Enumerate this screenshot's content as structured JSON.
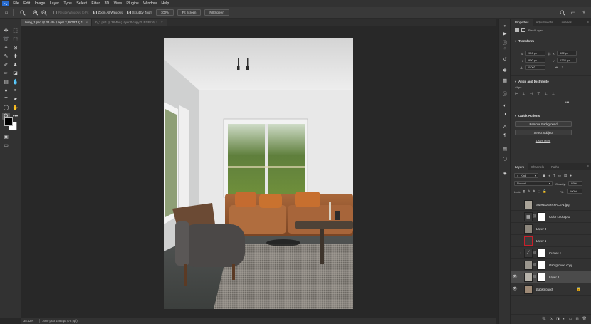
{
  "menubar": {
    "logo": "Ps",
    "items": [
      "File",
      "Edit",
      "Image",
      "Layer",
      "Type",
      "Select",
      "Filter",
      "3D",
      "View",
      "Plugins",
      "Window",
      "Help"
    ]
  },
  "options": {
    "scrubby_hidden": "Resize Windows to Fit",
    "zoom_all_windows": "Zoom All Windows",
    "scrubby_zoom": "Scrubby Zoom",
    "zoom_100": "100%",
    "fit_screen": "Fit Screen",
    "fill_screen": "Fill Screen"
  },
  "tabs": [
    {
      "label": "living_1.psd @ 38.4% (Layer 2, RGB/16) *",
      "active": true
    },
    {
      "label": "b_1.psd @ 38.4% (Layer 0 copy 2, RGB/16) *",
      "active": false
    }
  ],
  "status": {
    "zoom": "38.42%",
    "doc_info": "1600 px x 2286 px (72 ppi)"
  },
  "properties": {
    "tabs": [
      "Properties",
      "Adjustments",
      "Libraries"
    ],
    "kind_label": "Pixel Layer",
    "transform_title": "Transform",
    "w_label": "W",
    "w_value": "996 px",
    "h_label": "H",
    "h_value": "990 px",
    "x_label": "X",
    "x_value": "622 px",
    "y_label": "Y",
    "y_value": "1232 px",
    "angle_value": "0.00°",
    "align_title": "Align and Distribute",
    "align_label": "Align:",
    "quick_title": "Quick Actions",
    "remove_bg": "Remove Background",
    "select_subject": "Select Subject",
    "learn_more": "Learn More"
  },
  "layers_panel": {
    "tabs": [
      "Layers",
      "Channels",
      "Paths"
    ],
    "filter_kind": "Kind",
    "blend_mode": "Normal",
    "opacity_label": "Opacity:",
    "opacity_value": "99%",
    "lock_label": "Lock:",
    "fill_label": "Fill:",
    "fill_value": "100%",
    "layers": [
      {
        "name": "SMREDERRFACE-1.jpg",
        "visible": false,
        "type": "image",
        "selected": false
      },
      {
        "name": "Color Lookup 1",
        "visible": false,
        "type": "adjustment",
        "selected": false
      },
      {
        "name": "Layer 3",
        "visible": false,
        "type": "image",
        "selected": false
      },
      {
        "name": "Layer 1",
        "visible": false,
        "type": "red",
        "selected": false
      },
      {
        "name": "Curves 1",
        "visible": false,
        "type": "adjustment",
        "selected": false
      },
      {
        "name": "Background copy",
        "visible": false,
        "type": "masked",
        "selected": false
      },
      {
        "name": "Layer 2",
        "visible": true,
        "type": "masked",
        "selected": true
      },
      {
        "name": "Background",
        "visible": true,
        "type": "image",
        "selected": false,
        "locked": true
      }
    ]
  },
  "colors": {
    "foreground": "#000000",
    "background": "#ffffff",
    "accent": "#2a6dd0"
  }
}
